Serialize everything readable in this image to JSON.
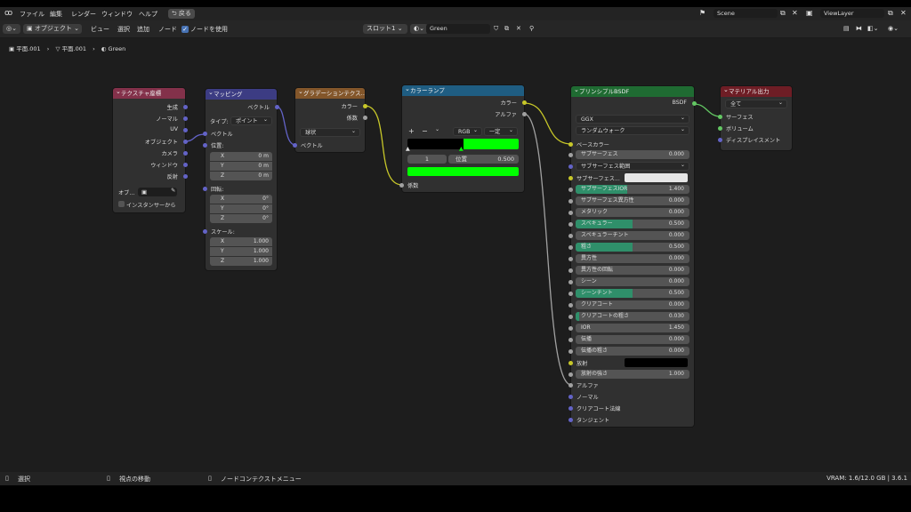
{
  "topbar": {
    "menus": [
      "ファイル",
      "編集",
      "レンダー",
      "ウィンドウ",
      "ヘルプ"
    ],
    "back": "戻る",
    "scene": "Scene",
    "viewlayer": "ViewLayer"
  },
  "header": {
    "mode": "オブジェクト",
    "menus": [
      "ビュー",
      "選択",
      "追加",
      "ノード"
    ],
    "use_nodes": "ノードを使用",
    "slot": "スロット1",
    "material": "Green"
  },
  "breadcrumb": [
    "平面.001",
    "平面.001",
    "Green"
  ],
  "nodes": {
    "texcoord": {
      "title": "テクスチャ座標",
      "outputs": [
        "生成",
        "ノーマル",
        "UV",
        "オブジェクト",
        "カメラ",
        "ウィンドウ",
        "反射"
      ],
      "object_label": "オブ…",
      "instancer": "インスタンサーから"
    },
    "mapping": {
      "title": "マッピング",
      "out": "ベクトル",
      "type_label": "タイプ:",
      "type_value": "ポイント",
      "in_vector": "ベクトル",
      "loc_label": "位置:",
      "loc": [
        {
          "a": "X",
          "v": "0 m"
        },
        {
          "a": "Y",
          "v": "0 m"
        },
        {
          "a": "Z",
          "v": "0 m"
        }
      ],
      "rot_label": "回転:",
      "rot": [
        {
          "a": "X",
          "v": "0°"
        },
        {
          "a": "Y",
          "v": "0°"
        },
        {
          "a": "Z",
          "v": "0°"
        }
      ],
      "scale_label": "スケール:",
      "scale": [
        {
          "a": "X",
          "v": "1.000"
        },
        {
          "a": "Y",
          "v": "1.000"
        },
        {
          "a": "Z",
          "v": "1.000"
        }
      ]
    },
    "gradient": {
      "title": "グラデーションテクス…",
      "out_color": "カラー",
      "out_fac": "係数",
      "type": "球状",
      "in_vector": "ベクトル"
    },
    "ramp": {
      "title": "カラーランプ",
      "out_color": "カラー",
      "out_alpha": "アルファ",
      "plus": "+",
      "minus": "−",
      "mode": "RGB",
      "interp": "一定",
      "index": "1",
      "pos_label": "位置",
      "pos_value": "0.500",
      "in_fac": "係数",
      "stop_color": "#00ff00",
      "colors": {
        "black": "#000000",
        "green": "#00ff00"
      }
    },
    "bsdf": {
      "title": "プリンシプルBSDF",
      "out": "BSDF",
      "distribution": "GGX",
      "sss_method": "ランダムウォーク",
      "base_color": "ベースカラー",
      "rows": [
        {
          "n": "サブサーフェス",
          "v": "0.000",
          "f": 0
        },
        {
          "n": "サブサーフェス範囲",
          "v": "",
          "f": -1
        },
        {
          "n": "サブサーフェス...",
          "v": "",
          "f": -2
        },
        {
          "n": "サブサーフェスIOR",
          "v": "1.400",
          "f": 0.45
        },
        {
          "n": "サブサーフェス異方性",
          "v": "0.000",
          "f": 0
        },
        {
          "n": "メタリック",
          "v": "0.000",
          "f": 0
        },
        {
          "n": "スペキュラー",
          "v": "0.500",
          "f": 0.5
        },
        {
          "n": "スペキュラーチント",
          "v": "0.000",
          "f": 0
        },
        {
          "n": "粗さ",
          "v": "0.500",
          "f": 0.5
        },
        {
          "n": "異方性",
          "v": "0.000",
          "f": 0
        },
        {
          "n": "異方性の回転",
          "v": "0.000",
          "f": 0
        },
        {
          "n": "シーン",
          "v": "0.000",
          "f": 0
        },
        {
          "n": "シーンチント",
          "v": "0.500",
          "f": 0.5
        },
        {
          "n": "クリアコート",
          "v": "0.000",
          "f": 0
        },
        {
          "n": "クリアコートの粗さ",
          "v": "0.030",
          "f": 0.03
        },
        {
          "n": "IOR",
          "v": "1.450",
          "f": 0
        },
        {
          "n": "伝播",
          "v": "0.000",
          "f": 0
        },
        {
          "n": "伝播の粗さ",
          "v": "0.000",
          "f": 0
        }
      ],
      "emission": "放射",
      "emission_strength": "放射の強さ",
      "emission_strength_value": "1.000",
      "inputs": [
        "アルファ",
        "ノーマル",
        "クリアコート法線",
        "タンジェント"
      ]
    },
    "output": {
      "title": "マテリアル出力",
      "target": "全て",
      "inputs": [
        "サーフェス",
        "ボリューム",
        "ディスプレイスメント"
      ]
    }
  },
  "status": {
    "select": "選択",
    "pan": "視点の移動",
    "context": "ノードコンテクストメニュー",
    "vram": "VRAM: 1.6/12.0 GB | 3.6.1"
  },
  "colors": {
    "texcoord": "#83314a",
    "mapping": "#3c3c83",
    "gradient": "#83562a",
    "ramp": "#1f5d82",
    "bsdf": "#1f6b32",
    "output": "#6e1d25",
    "accent": "#2f8f6a"
  }
}
